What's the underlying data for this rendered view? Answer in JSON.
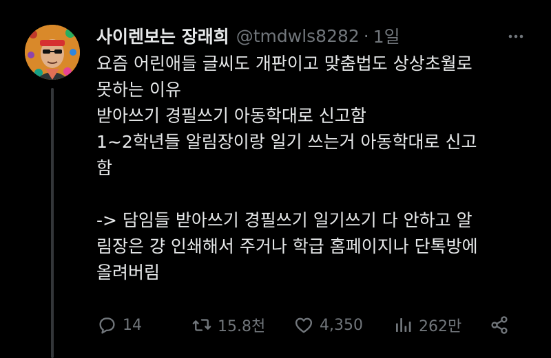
{
  "tweet": {
    "display_name": "사이렌보는 장래희",
    "handle": "@tmdwls8282",
    "separator": "·",
    "time": "1일",
    "body_lines": [
      "요즘 어린애들 글씨도 개판이고 맞춤법도 상상초월로",
      "못하는 이유",
      "받아쓰기 경필쓰기 아동학대로 신고함",
      "1~2학년들 알림장이랑 일기 쓰는거 아동학대로 신고",
      "함",
      "",
      "-> 담임들 받아쓰기 경필쓰기 일기쓰기 다 안하고 알",
      "림장은 걍 인쇄해서 주거나 학급 홈페이지나 단톡방에",
      "올려버림"
    ]
  },
  "actions": {
    "replies": "14",
    "retweets": "15.8천",
    "likes": "4,350",
    "views": "262만"
  },
  "icons": {
    "more": "more-dots-icon",
    "reply": "reply-bubble-icon",
    "retweet": "retweet-icon",
    "like": "heart-icon",
    "views": "views-bar-icon",
    "share": "share-icon"
  },
  "colors": {
    "background": "#000000",
    "text": "#e7e9ea",
    "muted": "#71767b",
    "thread_line": "#333639"
  }
}
